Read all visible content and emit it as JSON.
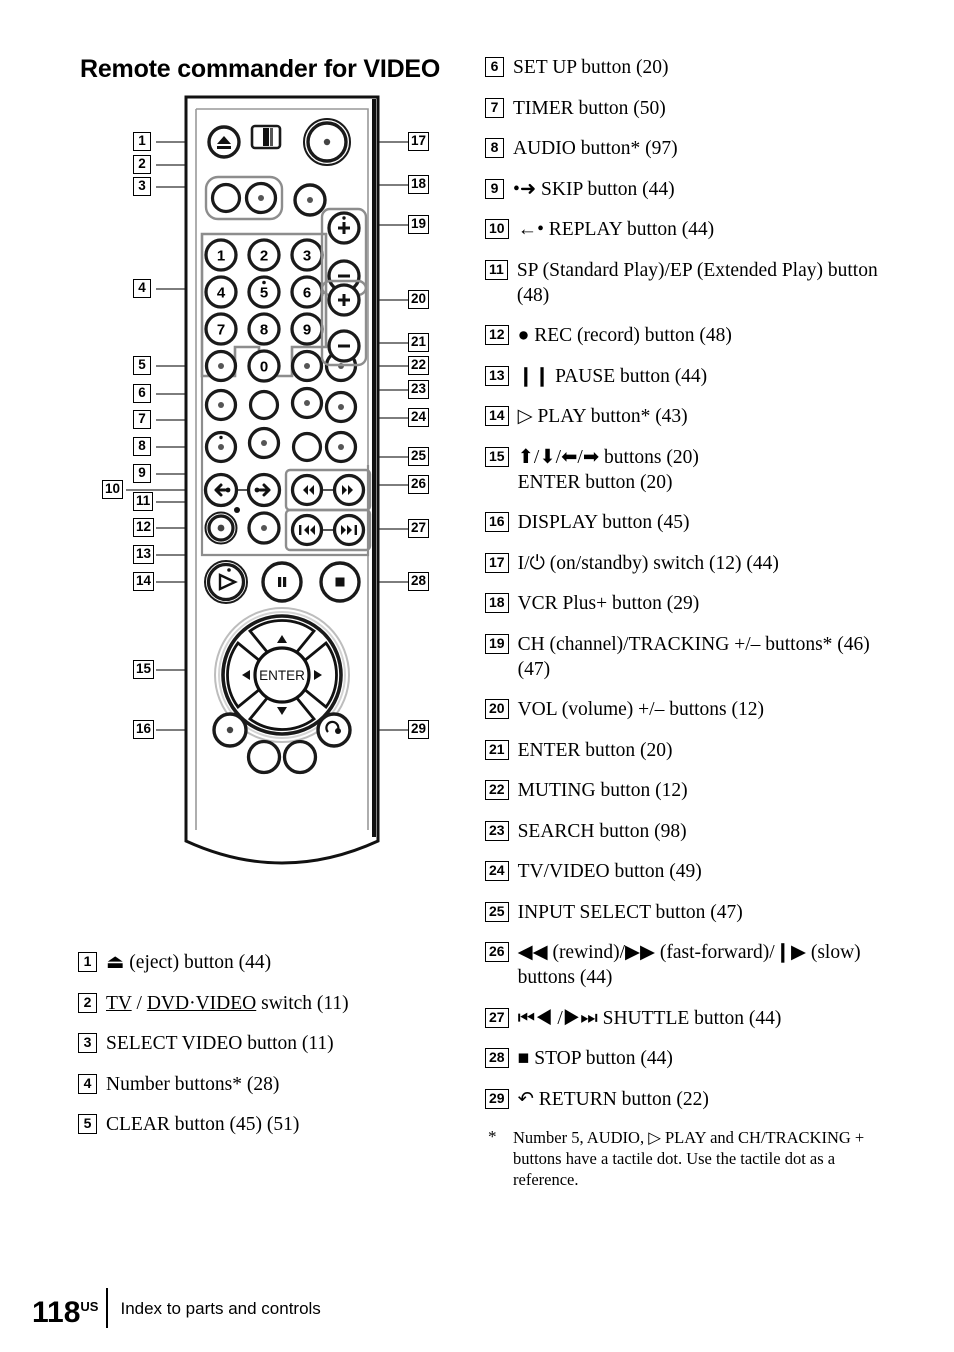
{
  "page": {
    "title": "Remote commander for VIDEO",
    "footer_page_number": "118",
    "footer_page_suffix": "US",
    "footer_caption": "Index to parts and controls"
  },
  "left_items": [
    {
      "num": "1",
      "text": "⏏ (eject) button (44)"
    },
    {
      "num": "2",
      "text": "TV / DVD·VIDEO switch (11)"
    },
    {
      "num": "3",
      "text": "SELECT VIDEO button (11)"
    },
    {
      "num": "4",
      "text": "Number buttons* (28)"
    },
    {
      "num": "5",
      "text": "CLEAR button (45) (51)"
    }
  ],
  "right_items": [
    {
      "num": "6",
      "text": "SET UP button (20)"
    },
    {
      "num": "7",
      "text": "TIMER button (50)"
    },
    {
      "num": "8",
      "text": "AUDIO button* (97)"
    },
    {
      "num": "9",
      "text": "•➜  SKIP button (44)"
    },
    {
      "num": "10",
      "text": "←•  REPLAY button (44)"
    },
    {
      "num": "11",
      "text": "SP (Standard Play)/EP (Extended Play) button (48)"
    },
    {
      "num": "12",
      "text": "● REC (record) button (48)"
    },
    {
      "num": "13",
      "text": "❙❙ PAUSE button (44)"
    },
    {
      "num": "14",
      "text": "▷ PLAY button* (43)"
    },
    {
      "num": "15",
      "text": "⬆/⬇/⬅/➡ buttons (20)\nENTER button (20)"
    },
    {
      "num": "16",
      "text": "DISPLAY button (45)"
    },
    {
      "num": "17",
      "text": "I/⏻ (on/standby) switch (12) (44)"
    },
    {
      "num": "18",
      "text": "VCR Plus+ button (29)"
    },
    {
      "num": "19",
      "text": "CH (channel)/TRACKING +/– buttons* (46) (47)"
    },
    {
      "num": "20",
      "text": "VOL (volume) +/– buttons (12)"
    },
    {
      "num": "21",
      "text": "ENTER button (20)"
    },
    {
      "num": "22",
      "text": "MUTING button (12)"
    },
    {
      "num": "23",
      "text": "SEARCH button (98)"
    },
    {
      "num": "24",
      "text": "TV/VIDEO button (49)"
    },
    {
      "num": "25",
      "text": "INPUT SELECT button (47)"
    },
    {
      "num": "26",
      "text": "◀◀ (rewind)/▶▶ (fast-forward)/❙▶ (slow) buttons (44)"
    },
    {
      "num": "27",
      "text": "⏮◀ /▶⏭ SHUTTLE button (44)"
    },
    {
      "num": "28",
      "text": "■ STOP button (44)"
    },
    {
      "num": "29",
      "text": "↶ RETURN button (22)"
    }
  ],
  "footnote": {
    "marker": "*",
    "text": "Number 5, AUDIO, ▷ PLAY and CH/TRACKING + buttons have a tactile dot. Use the tactile dot as a reference."
  },
  "diagram": {
    "keypad_labels": [
      "1",
      "2",
      "3",
      "4",
      "5",
      "6",
      "7",
      "8",
      "9",
      "0"
    ],
    "enter_label": "ENTER",
    "plus_label": "+",
    "minus_label": "–",
    "callouts_left": [
      "1",
      "2",
      "3",
      "4",
      "5",
      "6",
      "7",
      "8",
      "9",
      "10",
      "11",
      "12",
      "13",
      "14",
      "15",
      "16"
    ],
    "callouts_right": [
      "17",
      "18",
      "19",
      "20",
      "21",
      "22",
      "23",
      "24",
      "25",
      "26",
      "27",
      "28",
      "29"
    ]
  }
}
